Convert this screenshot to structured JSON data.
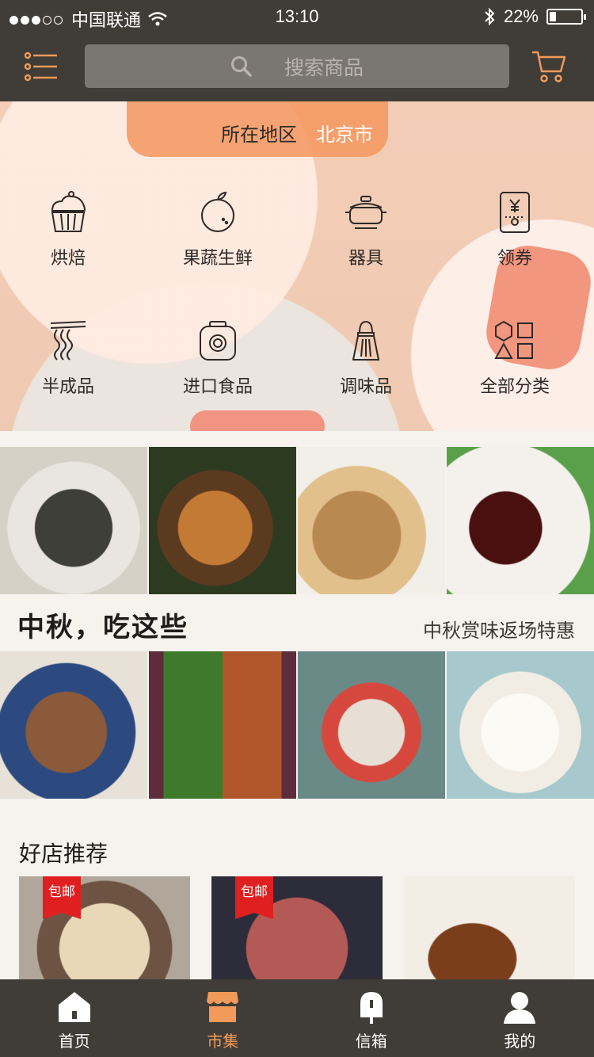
{
  "status_bar": {
    "carrier": "中国联通",
    "time": "13:10",
    "battery": "22%",
    "battery_level": 0.22
  },
  "header": {
    "search_placeholder": "搜索商品"
  },
  "hero": {
    "region_label": "所在地区",
    "region_city": "北京市"
  },
  "categories": [
    {
      "label": "烘焙",
      "icon": "cupcake-icon"
    },
    {
      "label": "果蔬生鲜",
      "icon": "fruit-icon"
    },
    {
      "label": "器具",
      "icon": "pot-icon"
    },
    {
      "label": "领券",
      "icon": "coupon-icon"
    },
    {
      "label": "半成品",
      "icon": "noodles-icon"
    },
    {
      "label": "进口食品",
      "icon": "can-icon"
    },
    {
      "label": "调味品",
      "icon": "seasoning-icon"
    },
    {
      "label": "全部分类",
      "icon": "shapes-icon"
    }
  ],
  "feature": {
    "title": "中秋，吃这些",
    "subtitle": "中秋赏味返场特惠"
  },
  "shops": {
    "title": "好店推荐",
    "tag": "包邮"
  },
  "tabs": [
    {
      "label": "首页",
      "icon": "home-icon",
      "active": false
    },
    {
      "label": "市集",
      "icon": "market-icon",
      "active": true
    },
    {
      "label": "信箱",
      "icon": "mailbox-icon",
      "active": false
    },
    {
      "label": "我的",
      "icon": "user-icon",
      "active": false
    }
  ],
  "colors": {
    "bar": "#403d38",
    "accent": "#f19a5a",
    "tag_red": "#e02020"
  }
}
